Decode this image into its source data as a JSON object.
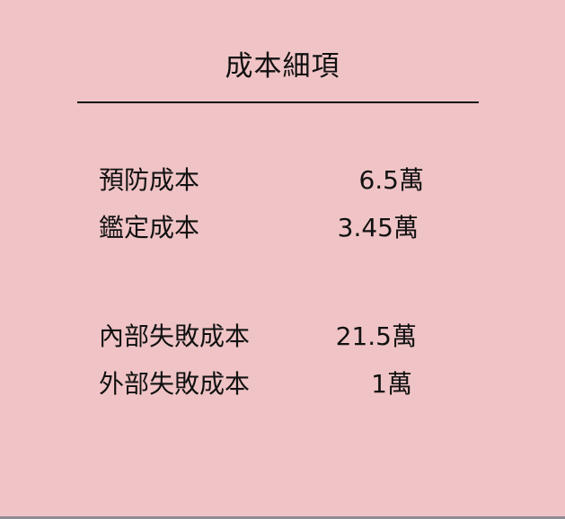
{
  "card": {
    "title": "成本細項"
  },
  "cost_items": [
    {
      "label": "預防成本",
      "value": "6.5萬"
    },
    {
      "label": "鑑定成本",
      "value": "3.45萬"
    },
    {
      "label": "內部失敗成本",
      "value": "21.5萬"
    },
    {
      "label": "外部失敗成本",
      "value": "1萬"
    }
  ],
  "colors": {
    "background": "#f0c4c6",
    "text": "#111111",
    "divider": "#111111"
  }
}
